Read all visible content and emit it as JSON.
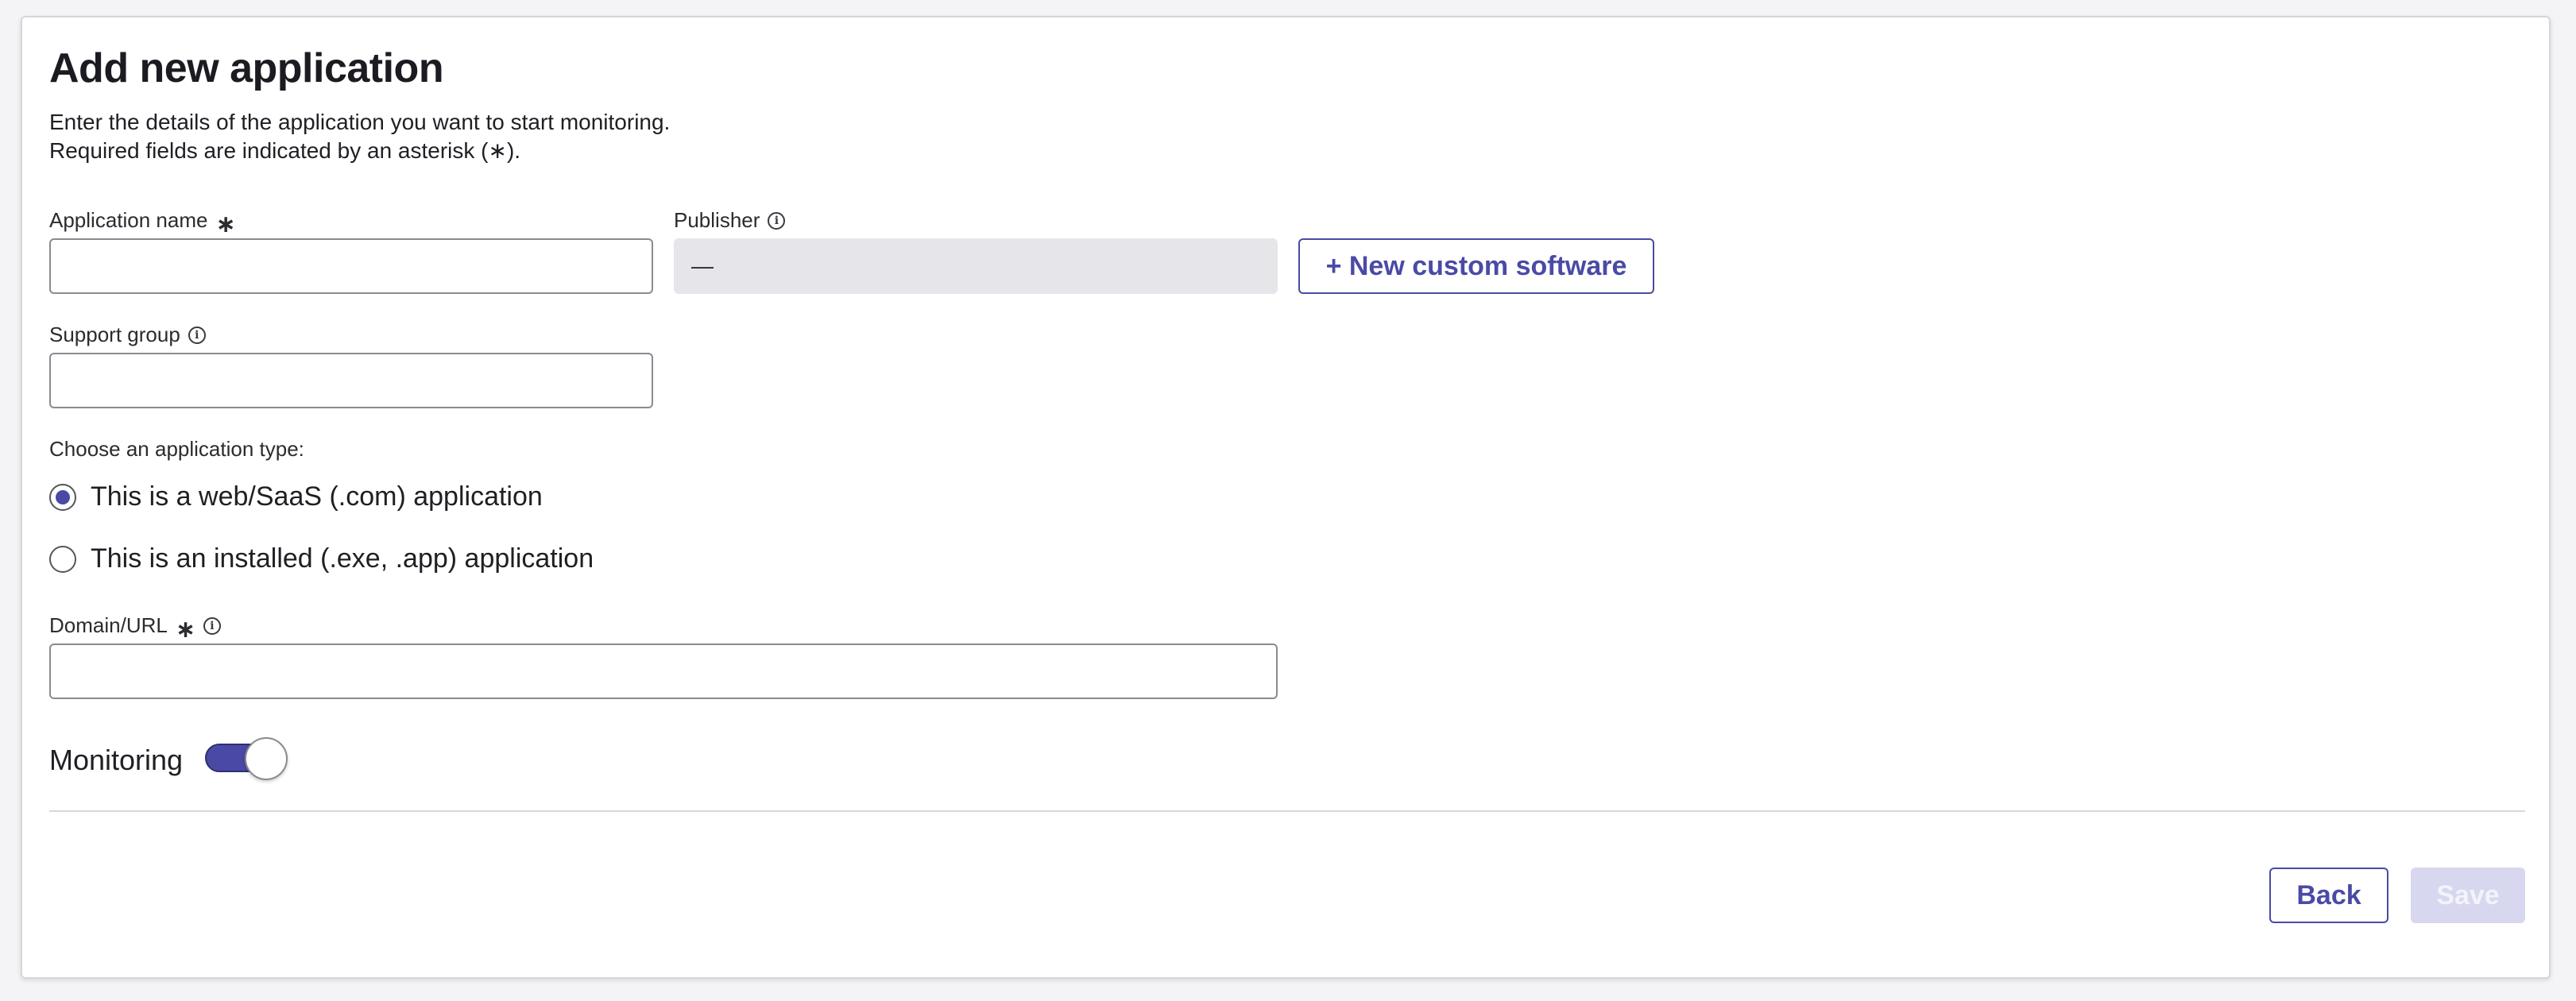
{
  "form": {
    "title": "Add new application",
    "description_line1": "Enter the details of the application you want to start monitoring.",
    "description_line2": "Required fields are indicated by an asterisk (∗).",
    "app_name_label": "Application name",
    "app_name_value": "",
    "publisher_label": "Publisher",
    "publisher_value": "—",
    "new_software_button": "+ New custom software",
    "support_group_label": "Support group",
    "support_group_value": "",
    "app_type_prompt": "Choose an application type:",
    "app_type_options": [
      {
        "label": "This is a web/SaaS (.com) application",
        "selected": true
      },
      {
        "label": "This is an installed (.exe, .app) application",
        "selected": false
      }
    ],
    "domain_label": "Domain/URL",
    "domain_value": "",
    "monitoring_label": "Monitoring",
    "monitoring_on": true,
    "asterisk": "∗",
    "info_glyph": "i"
  },
  "footer": {
    "back_label": "Back",
    "save_label": "Save"
  },
  "colors": {
    "accent": "#4a4aa6",
    "disabled": "#d7d7ef"
  }
}
